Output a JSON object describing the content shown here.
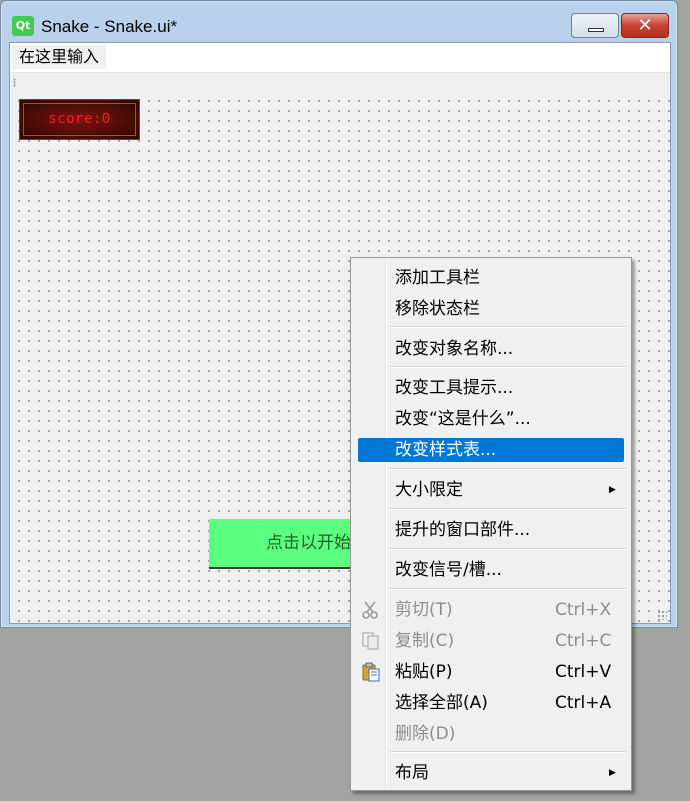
{
  "window": {
    "logo_text": "Qt",
    "title": "Snake - Snake.ui*",
    "close_glyph": "✕"
  },
  "menubar": {
    "input_placeholder": "在这里输入"
  },
  "form": {
    "score_label": "score:0",
    "start_button": "点击以开始"
  },
  "context_menu": {
    "items": [
      {
        "label": "添加工具栏"
      },
      {
        "label": "移除状态栏"
      },
      {
        "label": "改变对象名称..."
      },
      {
        "label": "改变工具提示..."
      },
      {
        "label": "改变“这是什么”..."
      },
      {
        "label": "改变样式表...",
        "highlighted": true
      },
      {
        "label": "大小限定",
        "submenu": true
      },
      {
        "label": "提升的窗口部件..."
      },
      {
        "label": "改变信号/槽..."
      },
      {
        "label": "剪切(T)",
        "shortcut": "Ctrl+X",
        "disabled": true,
        "icon": "scissors-icon"
      },
      {
        "label": "复制(C)",
        "shortcut": "Ctrl+C",
        "disabled": true,
        "icon": "copy-icon"
      },
      {
        "label": "粘贴(P)",
        "shortcut": "Ctrl+V",
        "icon": "paste-icon"
      },
      {
        "label": "选择全部(A)",
        "shortcut": "Ctrl+A"
      },
      {
        "label": "删除(D)",
        "disabled": true
      },
      {
        "label": "布局",
        "submenu": true
      }
    ],
    "submenu_arrow": "▶",
    "highlight_color": "#0078d7"
  },
  "colors": {
    "start_button_bg": "#5cff80",
    "score_text": "#ff1a1a",
    "qt_green": "#41cd52"
  }
}
